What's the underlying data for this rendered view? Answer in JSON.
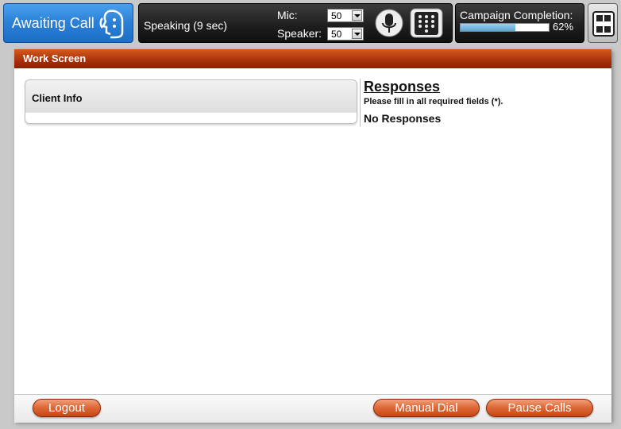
{
  "status": {
    "label": "Awaiting Call",
    "icon": "agent-face-icon"
  },
  "call": {
    "state": "Speaking (9 sec)",
    "mic_label": "Mic:",
    "mic_value": "50",
    "speaker_label": "Speaker:",
    "speaker_value": "50",
    "mic_icon": "microphone-icon",
    "dialpad_icon": "dialpad-icon"
  },
  "campaign": {
    "label": "Campaign Completion:",
    "percent_text": "62%",
    "percent": 62
  },
  "sidebar_toggle_icon": "sidebar-toggle-icon",
  "work_screen": {
    "title": "Work Screen",
    "client_info_title": "Client Info",
    "responses_title": "Responses",
    "responses_hint": "Please fill in all required fields (*).",
    "no_responses": "No Responses"
  },
  "footer": {
    "logout": "Logout",
    "manual_dial": "Manual Dial",
    "pause_calls": "Pause Calls"
  },
  "colors": {
    "status_blue": "#2a7fd6",
    "header_red": "#a8300a",
    "button_orange": "#df6a3a",
    "progress_fill": "#5aa6d6"
  }
}
